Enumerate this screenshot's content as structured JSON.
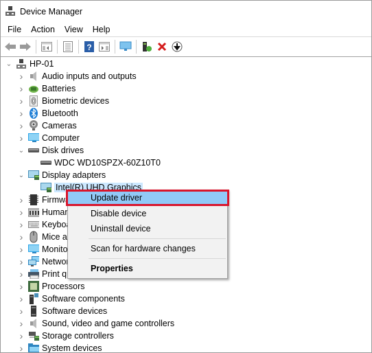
{
  "window": {
    "title": "Device Manager"
  },
  "menu": [
    "File",
    "Action",
    "View",
    "Help"
  ],
  "toolbar": [
    "back",
    "forward",
    "show-hide-console-tree",
    "properties",
    "help",
    "action-pane",
    "scan-hardware",
    "update-driver",
    "uninstall-device",
    "disable-device"
  ],
  "tree": {
    "root": "HP-01",
    "items": [
      {
        "label": "Audio inputs and outputs",
        "icon": "speaker-icon",
        "expanded": false
      },
      {
        "label": "Batteries",
        "icon": "battery-icon",
        "expanded": false
      },
      {
        "label": "Biometric devices",
        "icon": "fingerprint-icon",
        "expanded": false
      },
      {
        "label": "Bluetooth",
        "icon": "bluetooth-icon",
        "expanded": false
      },
      {
        "label": "Cameras",
        "icon": "camera-icon",
        "expanded": false
      },
      {
        "label": "Computer",
        "icon": "monitor-icon",
        "expanded": false
      },
      {
        "label": "Disk drives",
        "icon": "disk-icon",
        "expanded": true,
        "children": [
          "WDC WD10SPZX-60Z10T0"
        ]
      },
      {
        "label": "Display adapters",
        "icon": "display-adapter-icon",
        "expanded": true,
        "children": [
          "Intel(R) UHD Graphics"
        ]
      },
      {
        "label": "Firmware",
        "icon": "chip-icon",
        "expanded": false
      },
      {
        "label": "Human Interface Devices",
        "icon": "hid-icon",
        "expanded": false
      },
      {
        "label": "Keyboards",
        "icon": "keyboard-icon",
        "expanded": false
      },
      {
        "label": "Mice and other pointing devices",
        "icon": "mouse-icon",
        "expanded": false
      },
      {
        "label": "Monitors",
        "icon": "monitor-icon",
        "expanded": false
      },
      {
        "label": "Network adapters",
        "icon": "network-icon",
        "expanded": false
      },
      {
        "label": "Print queues",
        "icon": "printer-icon",
        "expanded": false
      },
      {
        "label": "Processors",
        "icon": "processor-icon",
        "expanded": false
      },
      {
        "label": "Software components",
        "icon": "software-component-icon",
        "expanded": false
      },
      {
        "label": "Software devices",
        "icon": "software-device-icon",
        "expanded": false
      },
      {
        "label": "Sound, video and game controllers",
        "icon": "speaker-icon",
        "expanded": false
      },
      {
        "label": "Storage controllers",
        "icon": "storage-icon",
        "expanded": false
      },
      {
        "label": "System devices",
        "icon": "system-folder-icon",
        "expanded": false
      }
    ]
  },
  "context_menu": {
    "items": [
      "Update driver",
      "Disable device",
      "Uninstall device",
      "Scan for hardware changes",
      "Properties"
    ],
    "highlighted": "Update driver",
    "highlight_border_color": "#d9142b",
    "highlight_fill_color": "#91c9f7"
  }
}
